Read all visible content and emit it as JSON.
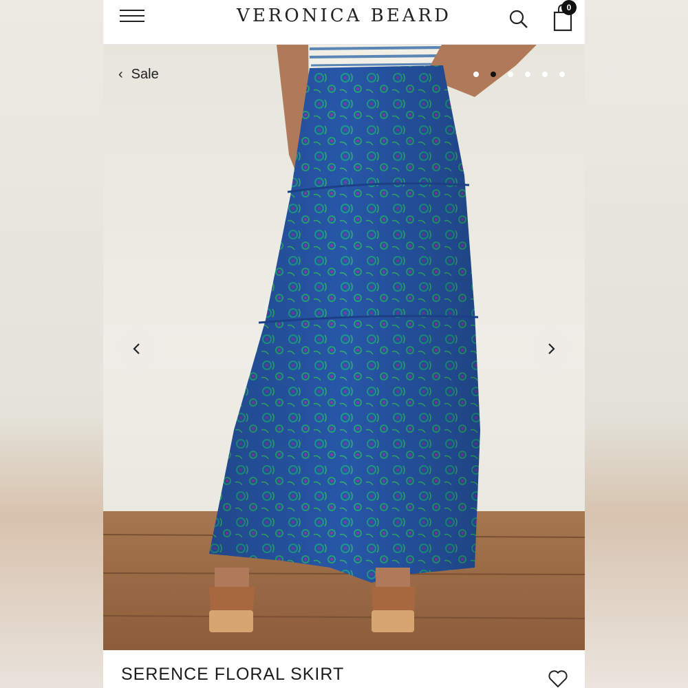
{
  "header": {
    "brand": "VERONICA BEARD",
    "cart_count": "0",
    "icons": [
      "menu-icon",
      "search-icon",
      "shopping-bag-icon"
    ]
  },
  "gallery": {
    "back_label": "Sale",
    "slides_total": 6,
    "active_slide": 2,
    "icons": [
      "chevron-left-icon",
      "chevron-right-icon"
    ]
  },
  "product": {
    "title": "SERENCE FLORAL SKIRT",
    "icons": [
      "heart-icon"
    ]
  },
  "colors": {
    "skirt": "#2a5fb0",
    "floor": "#9c6b45",
    "wall": "#e8e7df"
  }
}
